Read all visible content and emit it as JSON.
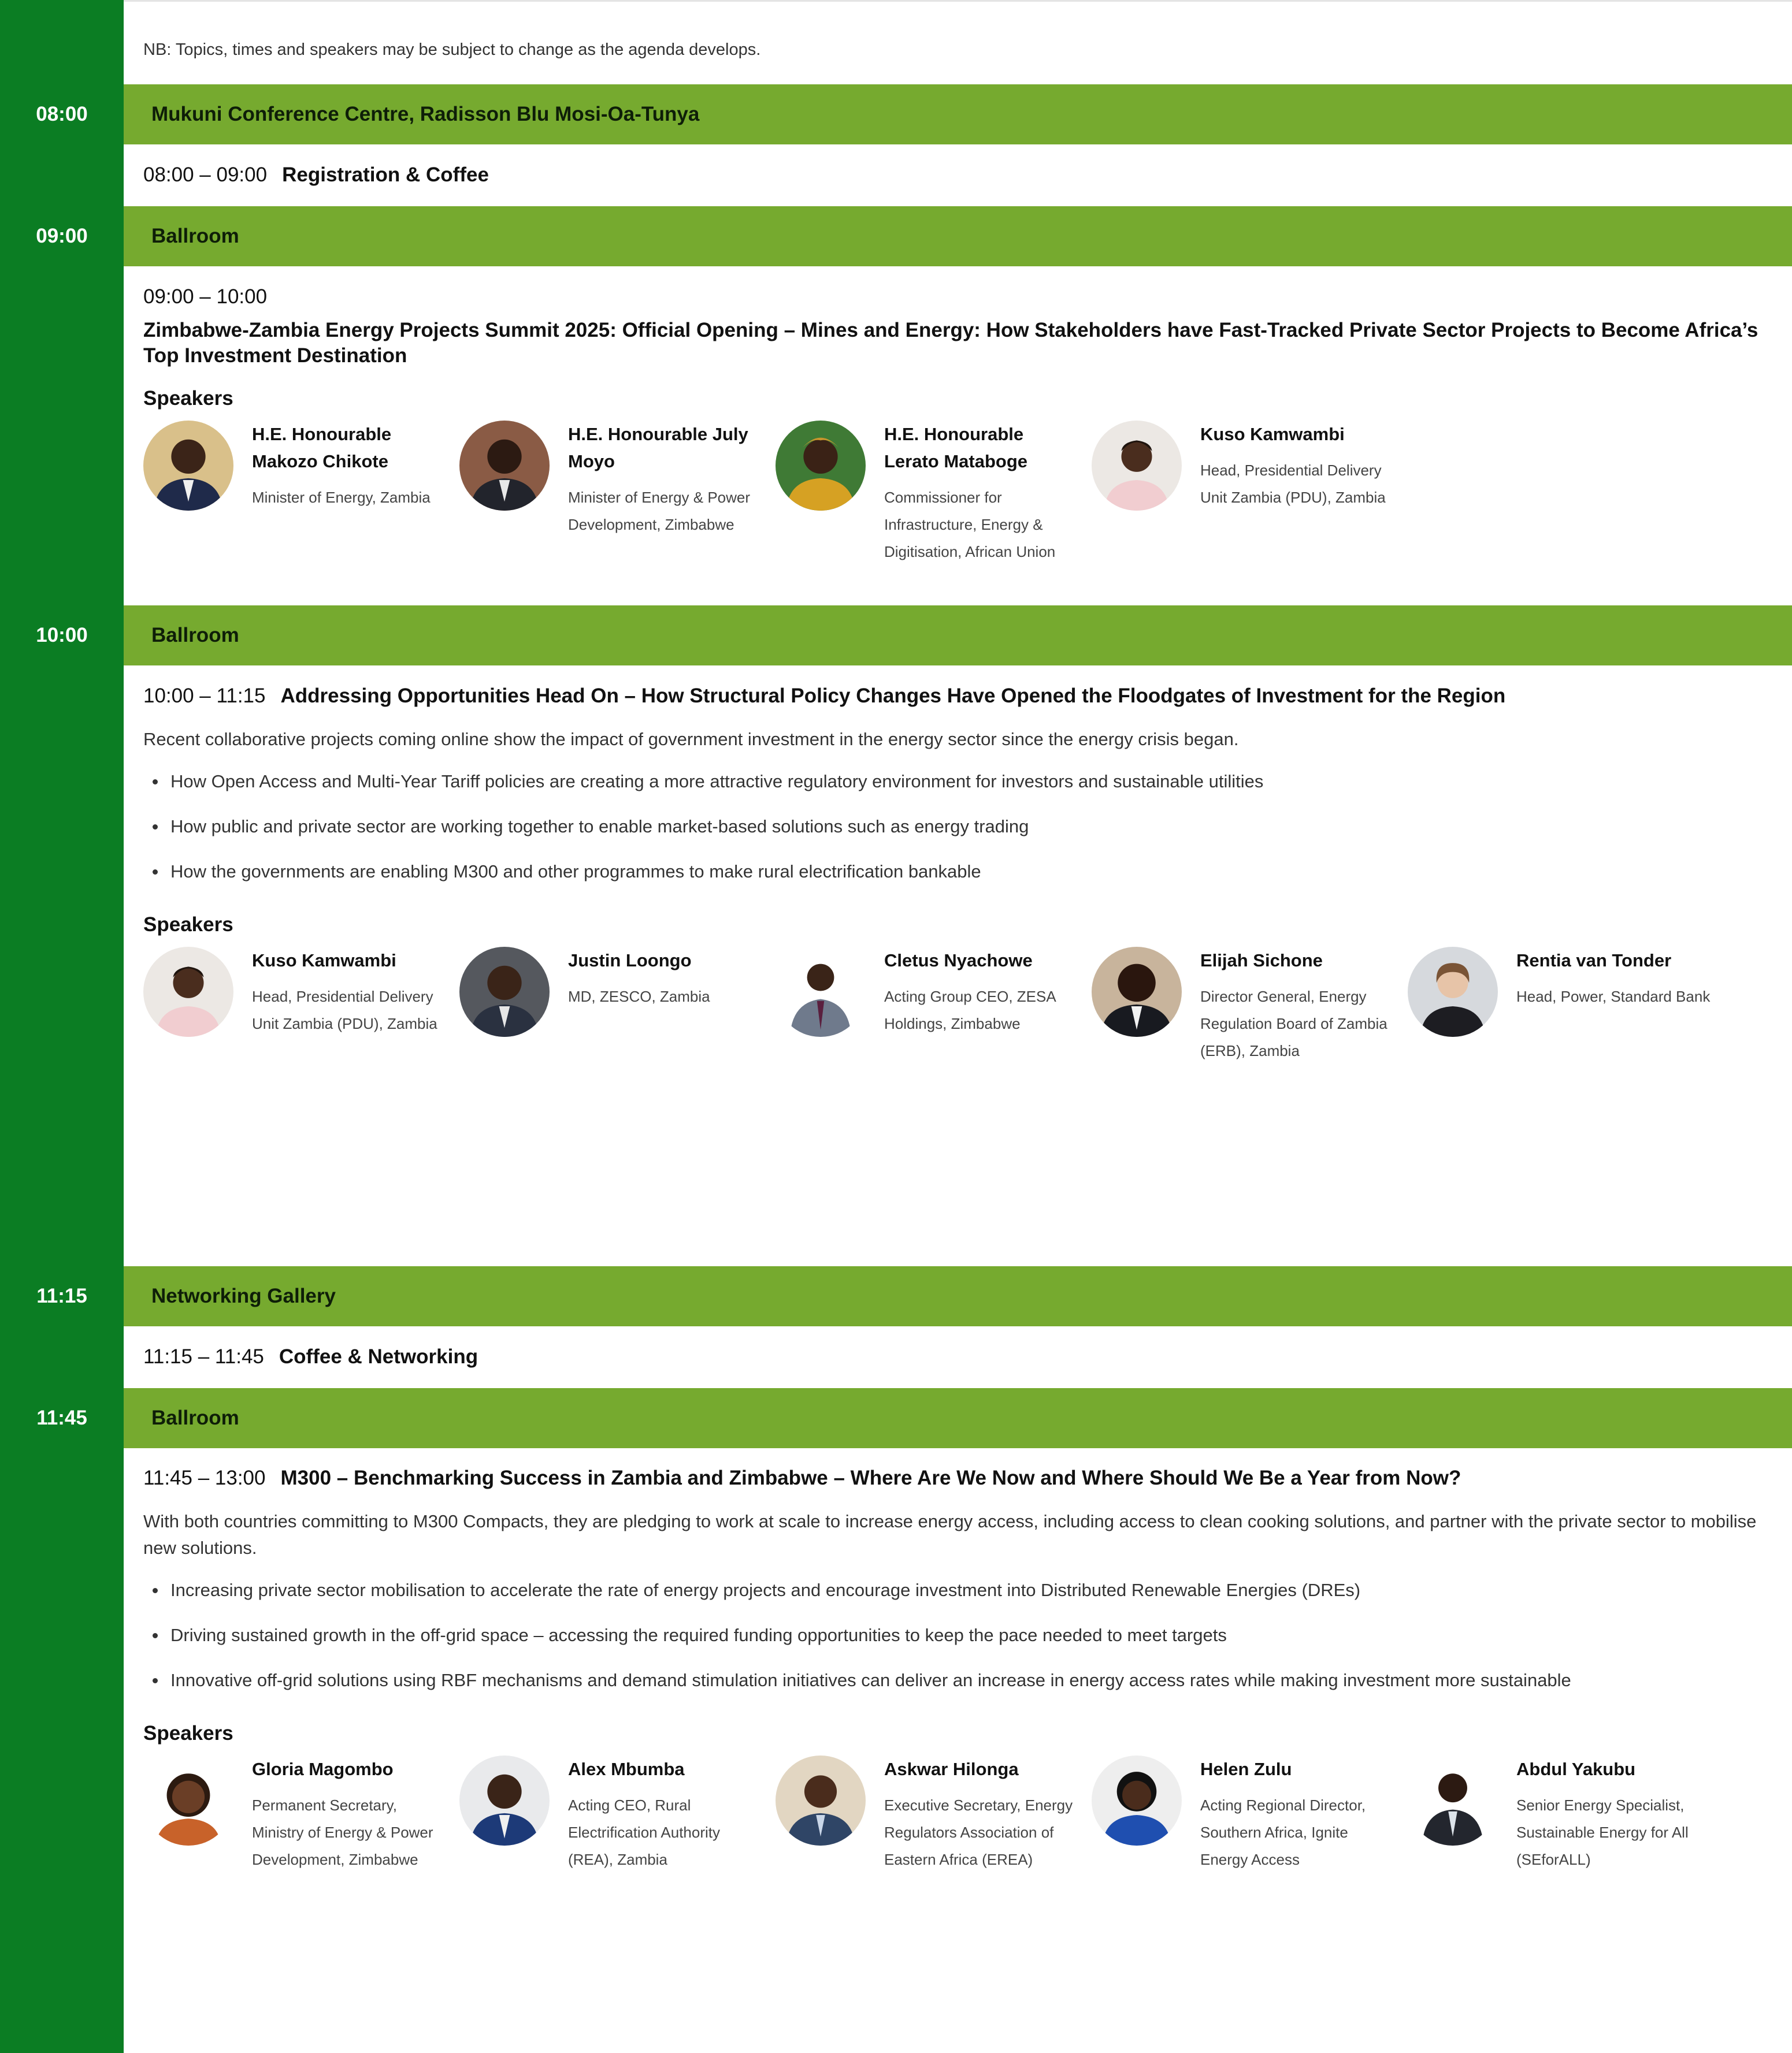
{
  "note": "NB: Topics, times and speakers may be subject to change as the agenda develops.",
  "times": {
    "t0800": "08:00",
    "t0900": "09:00",
    "t1000": "10:00",
    "t1115": "11:15",
    "t1145": "11:45"
  },
  "venues": {
    "v1": "Mukuni Conference Centre, Radisson Blu Mosi-Oa-Tunya",
    "v2": "Ballroom",
    "v3": "Ballroom",
    "v4": "Networking Gallery",
    "v5": "Ballroom"
  },
  "colors": {
    "time_column": "#0b7d23",
    "venue_bar": "#76aa2f"
  },
  "speakers_heading": "Speakers",
  "registration": {
    "time": "08:00 – 09:00",
    "title": "Registration & Coffee"
  },
  "opening": {
    "time": "09:00 – 10:00",
    "title": "Zimbabwe-Zambia Energy Projects Summit 2025: Official Opening – Mines and Energy: How Stakeholders have Fast-Tracked Private Sector Projects to Become Africa’s Top Investment Destination",
    "speakers": [
      {
        "name": "H.E. Honourable Makozo Chikote",
        "role": "Minister of Energy, Zambia",
        "icon": "portrait-photo"
      },
      {
        "name": "H.E. Honourable July Moyo",
        "role": "Minister of Energy & Power Development, Zimbabwe",
        "icon": "portrait-photo"
      },
      {
        "name": "H.E. Honourable Lerato Mataboge",
        "role": "Commissioner for Infrastructure, Energy & Digitisation, African Union",
        "icon": "portrait-photo"
      },
      {
        "name": "Kuso Kamwambi",
        "role": "Head, Presidential Delivery Unit Zambia (PDU), Zambia",
        "icon": "portrait-photo"
      }
    ]
  },
  "opportunities": {
    "time": "10:00 – 11:15",
    "title": "Addressing Opportunities Head On – How Structural Policy Changes Have Opened the Floodgates of Investment for the Region",
    "desc": "Recent collaborative projects coming online show the impact of government investment in the energy sector since the energy crisis began.",
    "bullets": [
      "How Open Access and Multi-Year Tariff policies are creating a more attractive regulatory environment for investors and sustainable utilities",
      "How public and private sector are working together to enable market-based solutions such as energy trading",
      "How the governments are enabling M300 and other programmes to make rural electrification bankable"
    ],
    "speakers": [
      {
        "name": "Kuso Kamwambi",
        "role": "Head, Presidential Delivery Unit Zambia (PDU), Zambia",
        "icon": "portrait-photo"
      },
      {
        "name": "Justin Loongo",
        "role": "MD, ZESCO, Zambia",
        "icon": "portrait-photo"
      },
      {
        "name": "Cletus Nyachowe",
        "role": "Acting Group CEO, ZESA Holdings, Zimbabwe",
        "icon": "portrait-photo"
      },
      {
        "name": "Elijah Sichone",
        "role": "Director General, Energy Regulation Board of Zambia (ERB), Zambia",
        "icon": "portrait-photo"
      },
      {
        "name": "Rentia van Tonder",
        "role": "Head, Power, Standard Bank",
        "icon": "portrait-photo"
      }
    ]
  },
  "coffee": {
    "time": "11:15 – 11:45",
    "title": "Coffee & Networking"
  },
  "m300": {
    "time": "11:45 – 13:00",
    "title": "M300 – Benchmarking Success in Zambia and Zimbabwe – Where Are We Now and Where Should We Be a Year from Now?",
    "desc": "With both countries committing to M300 Compacts, they are pledging to work at scale to increase energy access, including access to clean cooking solutions, and partner with the private sector to mobilise new solutions.",
    "bullets": [
      "Increasing private sector mobilisation to accelerate the rate of energy projects and encourage investment into Distributed Renewable Energies (DREs)",
      "Driving sustained growth in the off-grid space – accessing the required funding opportunities to keep the pace needed to meet targets",
      "Innovative off-grid solutions using RBF mechanisms and demand stimulation initiatives can deliver an increase in energy access rates while making investment more sustainable"
    ],
    "speakers": [
      {
        "name": "Gloria Magombo",
        "role": "Permanent Secretary, Ministry of Energy & Power Development, Zimbabwe",
        "icon": "portrait-photo"
      },
      {
        "name": "Alex Mbumba",
        "role": "Acting CEO, Rural Electrification Authority (REA), Zambia",
        "icon": "portrait-photo"
      },
      {
        "name": "Askwar Hilonga",
        "role": "Executive Secretary, Energy Regulators Association of Eastern Africa (EREA)",
        "icon": "portrait-photo"
      },
      {
        "name": "Helen Zulu",
        "role": "Acting Regional Director, Southern Africa, Ignite Energy Access",
        "icon": "portrait-photo"
      },
      {
        "name": "Abdul Yakubu",
        "role": "Senior Energy Specialist, Sustainable Energy for All (SEforALL)",
        "icon": "portrait-photo"
      }
    ]
  }
}
